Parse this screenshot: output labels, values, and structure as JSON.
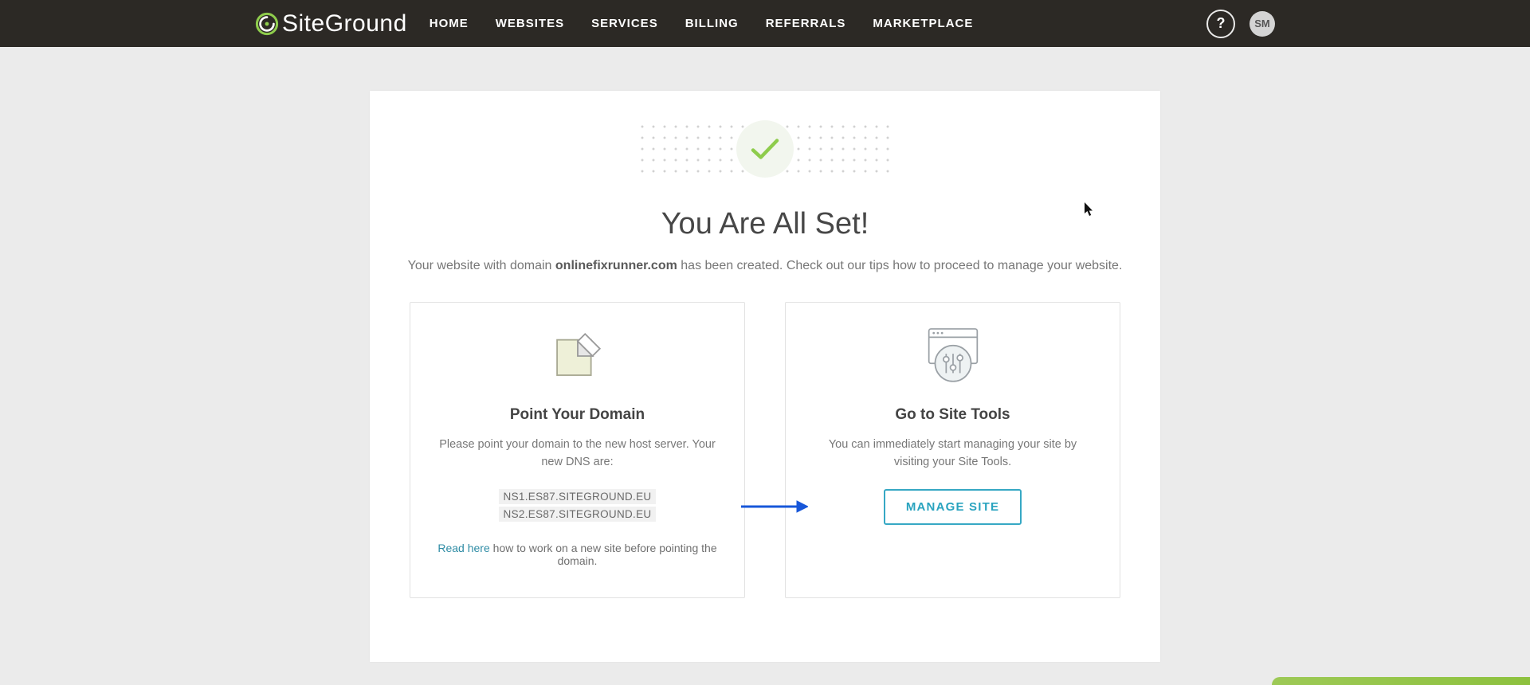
{
  "brand": {
    "name": "SiteGround"
  },
  "nav": {
    "items": [
      {
        "label": "HOME"
      },
      {
        "label": "WEBSITES"
      },
      {
        "label": "SERVICES"
      },
      {
        "label": "BILLING"
      },
      {
        "label": "REFERRALS"
      },
      {
        "label": "MARKETPLACE"
      }
    ]
  },
  "header": {
    "help_tooltip": "?",
    "avatar_initials": "SM"
  },
  "hero": {
    "title": "You Are All Set!",
    "subtitle_pre": "Your website with domain ",
    "subtitle_domain": "onlinefixrunner.com",
    "subtitle_post": " has been created. Check out our tips how to proceed to manage your website."
  },
  "cards": {
    "domain": {
      "title": "Point Your Domain",
      "text": "Please point your domain to the new host server. Your new DNS are:",
      "ns": [
        "NS1.ES87.SITEGROUND.EU",
        "NS2.ES87.SITEGROUND.EU"
      ],
      "read_link": "Read here",
      "read_rest": " how to work on a new site before pointing the domain."
    },
    "tools": {
      "title": "Go to Site Tools",
      "text": "You can immediately start managing your site by visiting your Site Tools.",
      "button": "MANAGE SITE"
    }
  }
}
